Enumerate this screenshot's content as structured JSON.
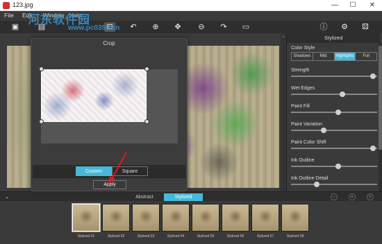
{
  "window": {
    "title": "123.jpg",
    "minimize": "—",
    "maximize": "☐",
    "close": "✕"
  },
  "menu": {
    "file": "File",
    "edit": "Edit",
    "window": "Window",
    "help": "Help"
  },
  "watermark": {
    "line1": "河东软件园",
    "line2": "www.pc0359.cn"
  },
  "toolbar_icons": [
    "open-icon",
    "save-icon",
    "crop-icon",
    "rotate-left-icon",
    "zoom-in-icon",
    "move-icon",
    "zoom-out-icon",
    "redo-icon",
    "fit-icon",
    "info-icon",
    "settings-icon",
    "random-icon"
  ],
  "crop_dialog": {
    "title": "Crop",
    "custom_label": "Custom",
    "square_label": "Square",
    "apply_label": "Apply"
  },
  "panel": {
    "title": "Stylized",
    "color_style_label": "Color Style",
    "color_styles": [
      "Shadows",
      "Mid",
      "Highlights",
      "Full"
    ],
    "selected_color_style": "Highlights",
    "sliders": [
      {
        "label": "Strength",
        "value": 0.95
      },
      {
        "label": "Wet Edges",
        "value": 0.6
      },
      {
        "label": "Paint Fill",
        "value": 0.55
      },
      {
        "label": "Paint Variation",
        "value": 0.38
      },
      {
        "label": "Paint Color Shift",
        "value": 0.95
      },
      {
        "label": "Ink Outline",
        "value": 0.55
      },
      {
        "label": "Ink Outline Detail",
        "value": 0.3
      }
    ]
  },
  "tabs": {
    "abstract": "Abstract",
    "stylized": "Stylized"
  },
  "thumbnails": [
    "Stylized 01",
    "Stylized 02",
    "Stylized 03",
    "Stylized 04",
    "Stylized 05",
    "Stylized 06",
    "Stylized 07",
    "Stylized 08"
  ],
  "accent_color": "#46b8d8"
}
